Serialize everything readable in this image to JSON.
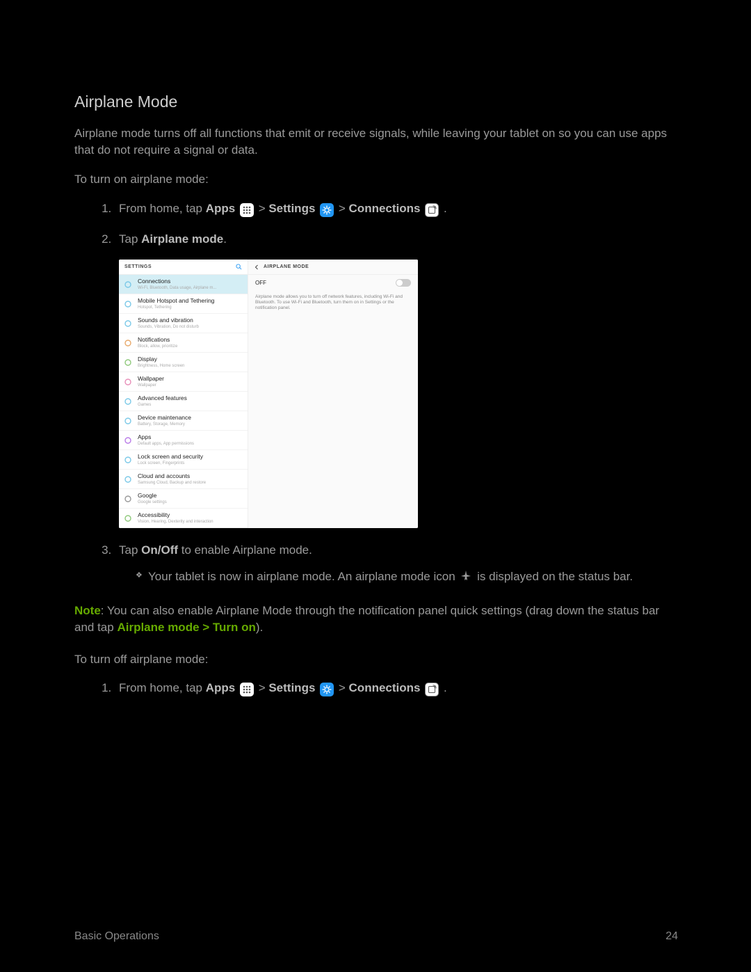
{
  "section_title": "Airplane Mode",
  "intro": "Airplane mode turns off all functions that emit or receive signals, while leaving your tablet on so you can use apps that do not require a signal or data.",
  "to_on": "To turn on airplane mode:",
  "step_prefix": "From home, tap ",
  "label_apps": "Apps",
  "sep1": " > ",
  "label_settings": "Settings",
  "sep2": " > ",
  "label_connections": "Connections",
  "period": ".",
  "step2_pre": "Tap ",
  "step2_bold": "Airplane mode",
  "step3_pre": "Tap ",
  "step3_bold": "On/Off",
  "step3_post": " to enable Airplane mode.",
  "sub_bullet": "Your tablet is now in airplane mode. An airplane mode icon ",
  "sub_bullet_post": " is displayed on the status bar.",
  "note_label": "Note",
  "note_body": ": You can also enable Airplane Mode through the notification panel quick settings (drag down the status bar and tap ",
  "note_bold": "Airplane mode > Turn on",
  "note_end": ").",
  "to_off": "To turn off airplane mode:",
  "footer_left": "Basic Operations",
  "footer_right": "24",
  "ss": {
    "header_settings": "SETTINGS",
    "header_airplane": "AIRPLANE MODE",
    "off_label": "OFF",
    "desc": "Airplane mode allows you to turn off network features, including Wi-Fi and Bluetooth. To use Wi-Fi and Bluetooth, turn them on in Settings or the notification panel.",
    "items": [
      {
        "t": "Connections",
        "s": "Wi-Fi, Bluetooth, Data usage, Airplane m..."
      },
      {
        "t": "Mobile Hotspot and Tethering",
        "s": "Hotspot, Tethering"
      },
      {
        "t": "Sounds and vibration",
        "s": "Sounds, Vibration, Do not disturb"
      },
      {
        "t": "Notifications",
        "s": "Block, allow, prioritize"
      },
      {
        "t": "Display",
        "s": "Brightness, Home screen"
      },
      {
        "t": "Wallpaper",
        "s": "Wallpaper"
      },
      {
        "t": "Advanced features",
        "s": "Games"
      },
      {
        "t": "Device maintenance",
        "s": "Battery, Storage, Memory"
      },
      {
        "t": "Apps",
        "s": "Default apps, App permissions"
      },
      {
        "t": "Lock screen and security",
        "s": "Lock screen, Fingerprints"
      },
      {
        "t": "Cloud and accounts",
        "s": "Samsung Cloud, Backup and restore"
      },
      {
        "t": "Google",
        "s": "Google settings"
      },
      {
        "t": "Accessibility",
        "s": "Vision, Hearing, Dexterity and interaction"
      }
    ]
  },
  "icon_colors": [
    "#7bc9e8",
    "#7bc9e8",
    "#7bc9e8",
    "#e8a96b",
    "#8fc97b",
    "#e88fb9",
    "#7bc9e8",
    "#7bc9e8",
    "#b97be8",
    "#7bc9e8",
    "#7bc9e8",
    "#999",
    "#8fc97b"
  ]
}
